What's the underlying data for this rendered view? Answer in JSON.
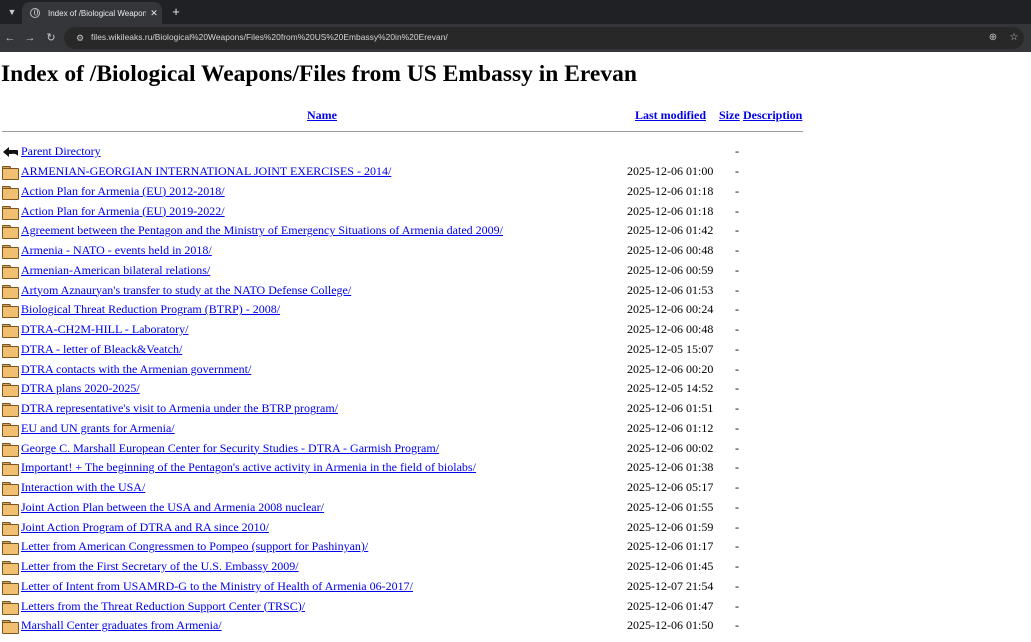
{
  "browser": {
    "tab_title": "Index of /Biological Weapons/F",
    "tab_close": "✕",
    "new_tab": "+",
    "url": "files.wikileaks.ru/Biological%20Weapons/Files%20from%20US%20Embassy%20in%20Erevan/",
    "icons": {
      "tab_menu": "chevron-down-icon",
      "back": "back-arrow-icon",
      "forward": "forward-arrow-icon",
      "reload": "reload-icon",
      "site_info": "site-info-icon",
      "zoom": "zoom-icon",
      "bookmark": "star-icon"
    }
  },
  "page": {
    "title": "Index of /Biological Weapons/Files from US Embassy in Erevan",
    "columns": {
      "name": "Name",
      "last_modified": "Last modified",
      "size": "Size",
      "description": "Description"
    },
    "parent": {
      "name": "Parent Directory",
      "size": "-"
    },
    "entries": [
      {
        "name": "ARMENIAN-GEORGIAN INTERNATIONAL JOINT EXERCISES - 2014/",
        "modified": "2025-12-06 01:00",
        "size": "-"
      },
      {
        "name": "Action Plan for Armenia (EU) 2012-2018/",
        "modified": "2025-12-06 01:18",
        "size": "-"
      },
      {
        "name": "Action Plan for Armenia (EU) 2019-2022/",
        "modified": "2025-12-06 01:18",
        "size": "-"
      },
      {
        "name": "Agreement between the Pentagon and the Ministry of Emergency Situations of Armenia dated 2009/",
        "modified": "2025-12-06 01:42",
        "size": "-"
      },
      {
        "name": "Armenia - NATO - events held in 2018/",
        "modified": "2025-12-06 00:48",
        "size": "-"
      },
      {
        "name": "Armenian-American bilateral relations/",
        "modified": "2025-12-06 00:59",
        "size": "-"
      },
      {
        "name": "Artyom Aznauryan's transfer to study at the NATO Defense College/",
        "modified": "2025-12-06 01:53",
        "size": "-"
      },
      {
        "name": "Biological Threat Reduction Program (BTRP) - 2008/",
        "modified": "2025-12-06 00:24",
        "size": "-"
      },
      {
        "name": "DTRA-CH2M-HILL - Laboratory/",
        "modified": "2025-12-06 00:48",
        "size": "-"
      },
      {
        "name": "DTRA - letter of Bleack&Veatch/",
        "modified": "2025-12-05 15:07",
        "size": "-"
      },
      {
        "name": "DTRA contacts with the Armenian government/",
        "modified": "2025-12-06 00:20",
        "size": "-"
      },
      {
        "name": "DTRA plans 2020-2025/",
        "modified": "2025-12-05 14:52",
        "size": "-"
      },
      {
        "name": "DTRA representative's visit to Armenia under the BTRP program/",
        "modified": "2025-12-06 01:51",
        "size": "-"
      },
      {
        "name": "EU and UN grants for Armenia/",
        "modified": "2025-12-06 01:12",
        "size": "-"
      },
      {
        "name": "George C. Marshall European Center for Security Studies - DTRA - Garmish Program/",
        "modified": "2025-12-06 00:02",
        "size": "-"
      },
      {
        "name": "Important! + The beginning of the Pentagon's active activity in Armenia in the field of biolabs/",
        "modified": "2025-12-06 01:38",
        "size": "-"
      },
      {
        "name": "Interaction with the USA/",
        "modified": "2025-12-06 05:17",
        "size": "-"
      },
      {
        "name": "Joint Action Plan between the USA and Armenia 2008 nuclear/",
        "modified": "2025-12-06 01:55",
        "size": "-"
      },
      {
        "name": "Joint Action Program of DTRA and RA since 2010/",
        "modified": "2025-12-06 01:59",
        "size": "-"
      },
      {
        "name": "Letter from American Congressmen to Pompeo (support for Pashinyan)/",
        "modified": "2025-12-06 01:17",
        "size": "-"
      },
      {
        "name": "Letter from the First Secretary of the U.S. Embassy 2009/",
        "modified": "2025-12-06 01:45",
        "size": "-"
      },
      {
        "name": "Letter of Intent from USAMRD-G to the Ministry of Health of Armenia 06-2017/",
        "modified": "2025-12-07 21:54",
        "size": "-"
      },
      {
        "name": "Letters from the Threat Reduction Support Center (TRSC)/",
        "modified": "2025-12-06 01:47",
        "size": "-"
      },
      {
        "name": "Marshall Center graduates from Armenia/",
        "modified": "2025-12-06 01:50",
        "size": "-"
      }
    ]
  }
}
